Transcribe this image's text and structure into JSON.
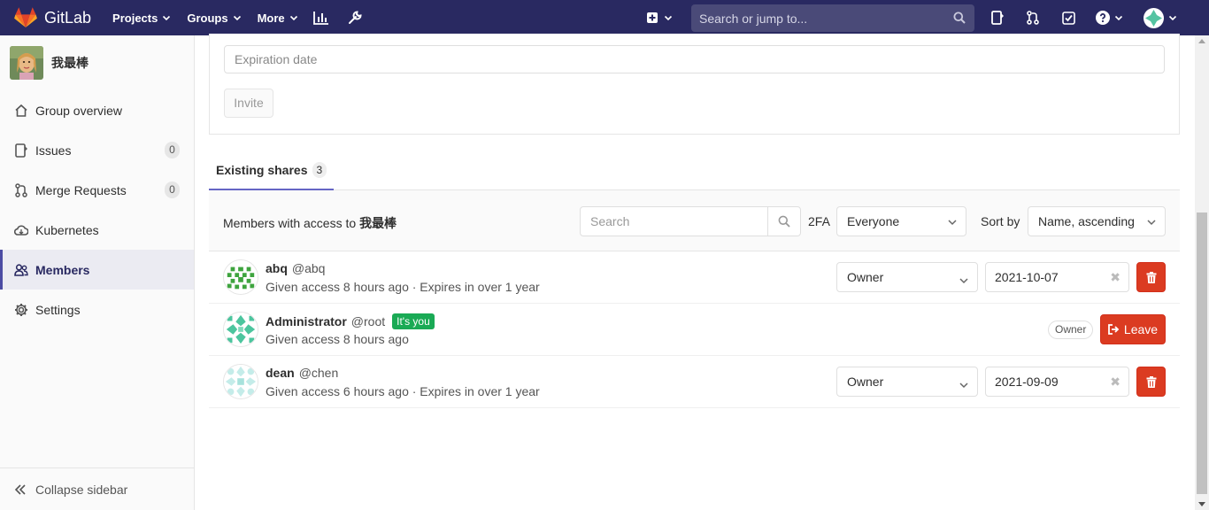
{
  "navbar": {
    "brand": "GitLab",
    "menu": [
      {
        "label": "Projects"
      },
      {
        "label": "Groups"
      },
      {
        "label": "More"
      }
    ],
    "search_placeholder": "Search or jump to...",
    "bg_color": "#292961"
  },
  "sidebar": {
    "group_name": "我最棒",
    "items": [
      {
        "label": "Group overview",
        "icon": "home-icon"
      },
      {
        "label": "Issues",
        "icon": "issues-icon",
        "count": "0"
      },
      {
        "label": "Merge Requests",
        "icon": "merge-request-icon",
        "count": "0"
      },
      {
        "label": "Kubernetes",
        "icon": "cloud-icon"
      },
      {
        "label": "Members",
        "icon": "members-icon",
        "active": true
      },
      {
        "label": "Settings",
        "icon": "settings-icon"
      }
    ],
    "collapse_label": "Collapse sidebar"
  },
  "invite": {
    "expiration_placeholder": "Expiration date",
    "invite_label": "Invite"
  },
  "tabs": {
    "existing_shares_label": "Existing shares",
    "existing_shares_count": "3"
  },
  "filter": {
    "title_prefix": "Members with access to",
    "group_name": "我最棒",
    "search_placeholder": "Search",
    "twofa_label": "2FA",
    "twofa_value": "Everyone",
    "sort_label": "Sort by",
    "sort_value": "Name, ascending"
  },
  "members": [
    {
      "name": "abq",
      "username": "@abq",
      "meta": "Given access 8 hours ago · Expires in over 1 year",
      "role": "Owner",
      "expires": "2021-10-07"
    },
    {
      "name": "Administrator",
      "username": "@root",
      "badge": "It's you",
      "meta": "Given access 8 hours ago",
      "role_badge": "Owner",
      "leave_label": "Leave"
    },
    {
      "name": "dean",
      "username": "@chen",
      "meta": "Given access 6 hours ago · Expires in over 1 year",
      "role": "Owner",
      "expires": "2021-09-09"
    }
  ],
  "colors": {
    "danger": "#db3b21",
    "success": "#1aaa55",
    "accent": "#6666c4"
  }
}
